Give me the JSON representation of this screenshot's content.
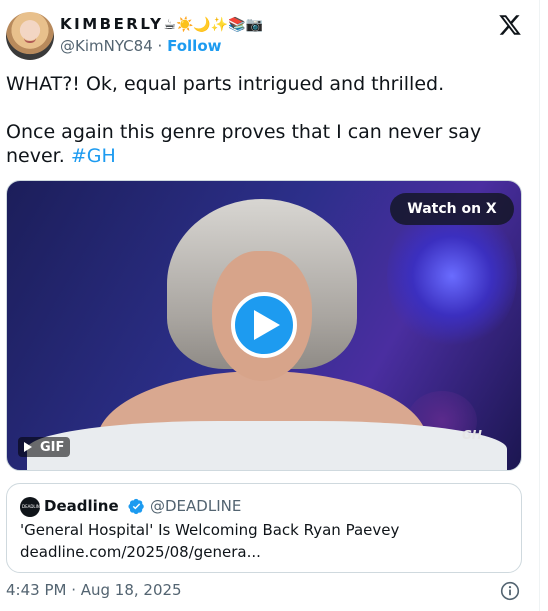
{
  "author": {
    "name": "KIMBERLY",
    "name_emojis": "☕☀️🌙✨📚📷",
    "handle": "@KimNYC84",
    "separator": "·",
    "follow_label": "Follow"
  },
  "tweet": {
    "text": "WHAT?! Ok, equal parts intrigued and thrilled.\n\nOnce again this genre proves that I can never say never. ",
    "hashtag": "#GH"
  },
  "media": {
    "watch_label": "Watch on X",
    "gif_label": "GIF",
    "watermark": "GH"
  },
  "quote": {
    "avatar_text": "DEADLINE",
    "name": "Deadline",
    "handle": "@DEADLINE",
    "title": "'General Hospital' Is Welcoming Back Ryan Paevey",
    "link": "deadline.com/2025/08/genera..."
  },
  "footer": {
    "timestamp": "4:43 PM · Aug 18, 2025"
  },
  "colors": {
    "accent": "#1d9bf0",
    "secondary_text": "#536471"
  }
}
